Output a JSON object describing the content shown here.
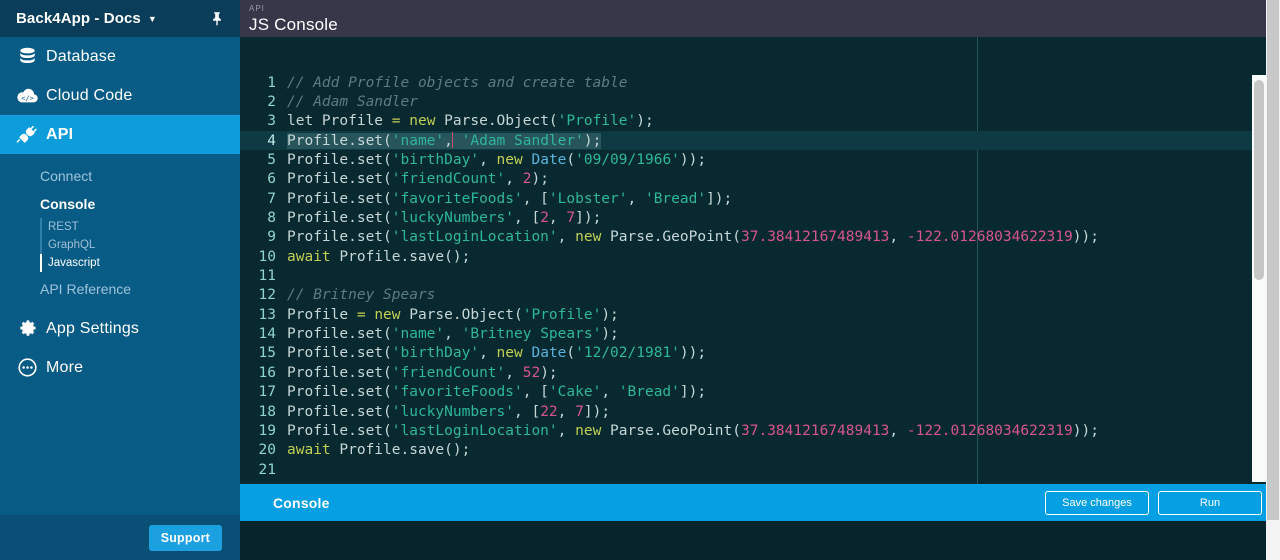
{
  "sidebar": {
    "app_title": "Back4App - Docs",
    "caret_icon": "chevron-down-icon",
    "pin_icon": "pin-icon",
    "nav": [
      {
        "label": "Database",
        "icon": "database-icon",
        "active": false
      },
      {
        "label": "Cloud Code",
        "icon": "cloud-code-icon",
        "active": false
      },
      {
        "label": "API",
        "icon": "api-plug-icon",
        "active": true
      }
    ],
    "subnav": {
      "connect": "Connect",
      "console": "Console",
      "children": [
        "REST",
        "GraphQL",
        "Javascript"
      ],
      "current_child": "Javascript",
      "api_reference": "API Reference"
    },
    "nav_bottom": [
      {
        "label": "App Settings",
        "icon": "gear-icon"
      },
      {
        "label": "More",
        "icon": "ellipsis-circle-icon"
      }
    ],
    "support_label": "Support",
    "accent_active": "#0d9ddb",
    "background": "#085b85"
  },
  "header": {
    "breadcrumb": "API",
    "title": "JS Console",
    "background": "#373749"
  },
  "editor": {
    "background": "#07292f",
    "highlighted_line": 4,
    "ruler_column": true,
    "lines": [
      {
        "n": 1,
        "text": "// Add Profile objects and create table"
      },
      {
        "n": 2,
        "text": "// Adam Sandler"
      },
      {
        "n": 3,
        "text": "let Profile = new Parse.Object('Profile');"
      },
      {
        "n": 4,
        "text": "Profile.set('name', 'Adam Sandler');"
      },
      {
        "n": 5,
        "text": "Profile.set('birthDay', new Date('09/09/1966'));"
      },
      {
        "n": 6,
        "text": "Profile.set('friendCount', 2);"
      },
      {
        "n": 7,
        "text": "Profile.set('favoriteFoods', ['Lobster', 'Bread']);"
      },
      {
        "n": 8,
        "text": "Profile.set('luckyNumbers', [2, 7]);"
      },
      {
        "n": 9,
        "text": "Profile.set('lastLoginLocation', new Parse.GeoPoint(37.38412167489413, -122.01268034622319));"
      },
      {
        "n": 10,
        "text": "await Profile.save();"
      },
      {
        "n": 11,
        "text": ""
      },
      {
        "n": 12,
        "text": "// Britney Spears"
      },
      {
        "n": 13,
        "text": "Profile = new Parse.Object('Profile');"
      },
      {
        "n": 14,
        "text": "Profile.set('name', 'Britney Spears');"
      },
      {
        "n": 15,
        "text": "Profile.set('birthDay', new Date('12/02/1981'));"
      },
      {
        "n": 16,
        "text": "Profile.set('friendCount', 52);"
      },
      {
        "n": 17,
        "text": "Profile.set('favoriteFoods', ['Cake', 'Bread']);"
      },
      {
        "n": 18,
        "text": "Profile.set('luckyNumbers', [22, 7]);"
      },
      {
        "n": 19,
        "text": "Profile.set('lastLoginLocation', new Parse.GeoPoint(37.38412167489413, -122.01268034622319));"
      },
      {
        "n": 20,
        "text": "await Profile.save();"
      },
      {
        "n": 21,
        "text": ""
      }
    ]
  },
  "console_bar": {
    "label": "Console",
    "save_label": "Save changes",
    "run_label": "Run",
    "background": "#05a0e4"
  }
}
